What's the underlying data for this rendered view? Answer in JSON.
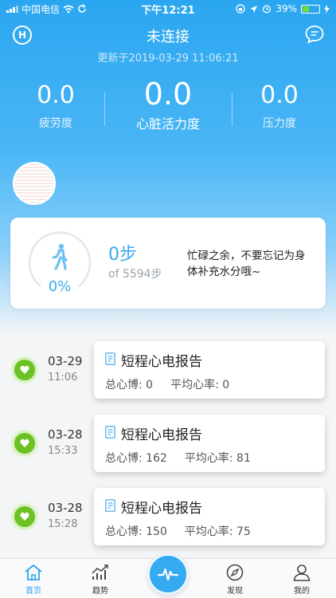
{
  "status_bar": {
    "carrier": "中国电信",
    "time": "下午12:21",
    "battery": "39%"
  },
  "header": {
    "title": "未连接",
    "updated": "更新于2019-03-29 11:06:21"
  },
  "metrics": {
    "fatigue": {
      "value": "0.0",
      "label": "疲劳度"
    },
    "heart": {
      "value": "0.0",
      "label": "心脏活力度"
    },
    "stress": {
      "value": "0.0",
      "label": "压力度"
    }
  },
  "steps": {
    "percent": "0%",
    "progress": 0,
    "count": "0步",
    "goal": "of 5594步",
    "tip": "忙碌之余，不要忘记为身体补充水分哦~"
  },
  "records": [
    {
      "date": "03-29",
      "time": "11:06",
      "title": "短程心电报告",
      "beats": "总心博: 0",
      "avg": "平均心率: 0"
    },
    {
      "date": "03-28",
      "time": "15:33",
      "title": "短程心电报告",
      "beats": "总心博: 162",
      "avg": "平均心率: 81"
    },
    {
      "date": "03-28",
      "time": "15:28",
      "title": "短程心电报告",
      "beats": "总心博: 150",
      "avg": "平均心率: 75"
    }
  ],
  "tabs": {
    "home": "首页",
    "trend": "趋势",
    "discover": "发现",
    "mine": "我的"
  },
  "colors": {
    "accent": "#2aa6f0",
    "heart_green": "#6cc224"
  }
}
